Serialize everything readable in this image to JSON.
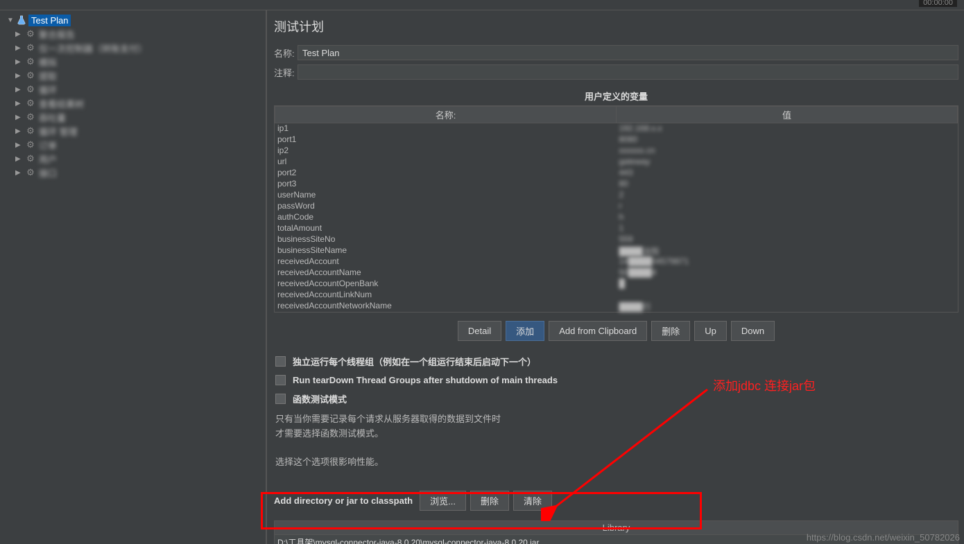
{
  "timer": "00:00:00",
  "tree": {
    "root_label": "Test Plan",
    "nodes": [
      "聚合报告",
      "仅一次控制器（转账支付）",
      "模拟",
      "提取",
      "循环",
      "查看结果树",
      "吞吐量",
      "循环 管理",
      "订单",
      "用户",
      "接口"
    ]
  },
  "panel": {
    "title": "测试计划",
    "name_label": "名称:",
    "name_value": "Test Plan",
    "comment_label": "注释:",
    "vars_title": "用户定义的变量",
    "col_name": "名称:",
    "col_value": "值",
    "vars": [
      {
        "n": "ip1",
        "v": "192.168.x.x"
      },
      {
        "n": "port1",
        "v": "8080"
      },
      {
        "n": "ip2",
        "v": "xxxxxx.cn"
      },
      {
        "n": "url",
        "v": "gateway"
      },
      {
        "n": "port2",
        "v": "443"
      },
      {
        "n": "port3",
        "v": "80"
      },
      {
        "n": "userName",
        "v": "2"
      },
      {
        "n": "passWord",
        "v": "r"
      },
      {
        "n": "authCode",
        "v": "h"
      },
      {
        "n": "totalAmount",
        "v": "1"
      },
      {
        "n": "businessSiteNo",
        "v": "559"
      },
      {
        "n": "businessSiteName",
        "v": "████法院"
      },
      {
        "n": "receivedAccount",
        "v": "14████04579871"
      },
      {
        "n": "receivedAccountName",
        "v": "50████4"
      },
      {
        "n": "receivedAccountOpenBank",
        "v": "█"
      },
      {
        "n": "receivedAccountLinkNum",
        "v": ""
      },
      {
        "n": "receivedAccountNetworkName",
        "v": "████行"
      }
    ],
    "buttons": {
      "detail": "Detail",
      "add": "添加",
      "clipboard": "Add from Clipboard",
      "delete": "删除",
      "up": "Up",
      "down": "Down"
    },
    "checks": {
      "c1": "独立运行每个线程组（例如在一个组运行结束后启动下一个）",
      "c2": "Run tearDown Thread Groups after shutdown of main threads",
      "c3": "函数测试模式"
    },
    "note1": "只有当你需要记录每个请求从服务器取得的数据到文件时",
    "note2": "才需要选择函数测试模式。",
    "note3": "选择这个选项很影响性能。",
    "classpath_label": "Add directory or jar to classpath",
    "browse": "浏览...",
    "del2": "删除",
    "clear": "清除",
    "lib_header": "Library",
    "lib_path": "D:\\工具架\\mysql-connector-java-8.0.20\\mysql-connector-java-8.0.20.jar"
  },
  "annotation": "添加jdbc 连接jar包",
  "watermark": "https://blog.csdn.net/weixin_50782026"
}
